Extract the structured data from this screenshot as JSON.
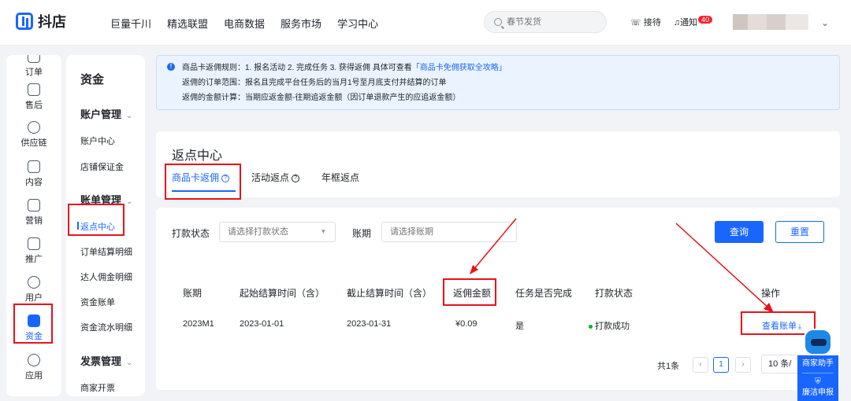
{
  "app": {
    "logo_text": "抖店"
  },
  "topnav": [
    "巨量千川",
    "精选联盟",
    "电商数据",
    "服务市场",
    "学习中心"
  ],
  "search": {
    "placeholder": "春节发货"
  },
  "top_actions": {
    "reception": "接待",
    "notice": "通知",
    "notice_count": "40"
  },
  "leftnav": [
    {
      "label": "订单",
      "icon": "order-icon"
    },
    {
      "label": "售后",
      "icon": "after-sale-icon"
    },
    {
      "label": "供应链",
      "icon": "supply-chain-icon"
    },
    {
      "label": "内容",
      "icon": "content-icon"
    },
    {
      "label": "营销",
      "icon": "marketing-icon"
    },
    {
      "label": "推广",
      "icon": "promotion-icon"
    },
    {
      "label": "用户",
      "icon": "user-icon"
    },
    {
      "label": "资金",
      "icon": "wallet-icon",
      "active": true
    },
    {
      "label": "应用",
      "icon": "app-icon"
    }
  ],
  "subnav": {
    "title": "资金",
    "groups": [
      {
        "label": "账户管理",
        "items": [
          "账户中心",
          "店铺保证金"
        ]
      },
      {
        "label": "账单管理",
        "items": [
          "返点中心",
          "订单结算明细",
          "达人佣金明细",
          "资金账单",
          "资金流水明细"
        ]
      },
      {
        "label": "发票管理",
        "items": [
          "商家开票"
        ]
      }
    ]
  },
  "notice": {
    "line1_prefix": "商品卡返佣规则：1. 报名活动 2. 完成任务 3. 获得返佣 具体可查看",
    "line1_link": "「商品卡免佣获取全攻略」",
    "line2": "返佣的订单范围：报名且完成平台任务后的当月1号至月底支付并结算的订单",
    "line3": "返佣的金额计算：当期应返金额-往期追返金额（因订单退款产生的应追返金额）"
  },
  "page": {
    "title": "返点中心",
    "tabs": [
      "商品卡返佣",
      "活动返点",
      "年框返点"
    ]
  },
  "filters": {
    "status_label": "打款状态",
    "status_placeholder": "请选择打款状态",
    "period_label": "账期",
    "period_placeholder": "请选择账期",
    "query_button": "查询",
    "reset_button": "重置"
  },
  "table": {
    "headers": [
      "账期",
      "起始结算时间（含）",
      "截止结算时间（含）",
      "返佣金额",
      "任务是否完成",
      "打款状态",
      "操作"
    ],
    "rows": [
      {
        "period": "2023M1",
        "start": "2023-01-01",
        "end": "2023-01-31",
        "amount": "¥0.09",
        "done": "是",
        "status": "打款成功",
        "action": "查看账单"
      }
    ]
  },
  "pagination": {
    "total": "共1条",
    "current": "1",
    "page_size": "10 条/"
  },
  "helper": {
    "label": "商家助手",
    "report": "廉洁申报"
  },
  "colors": {
    "accent": "#1966ff",
    "annotation": "#e8131a",
    "success": "#00b42a"
  }
}
